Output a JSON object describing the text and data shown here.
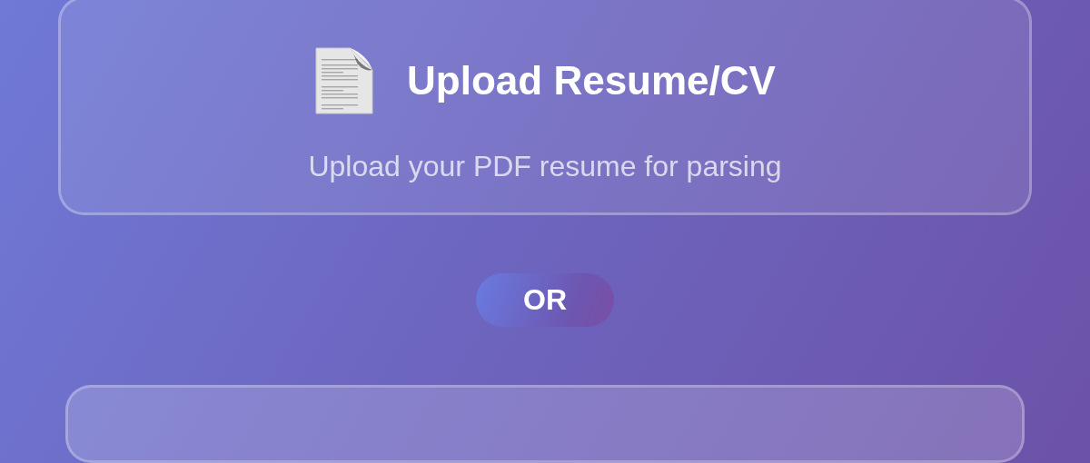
{
  "upload_card": {
    "title": "Upload Resume/CV",
    "subtitle": "Upload your PDF resume for parsing"
  },
  "divider": {
    "label": "OR"
  }
}
